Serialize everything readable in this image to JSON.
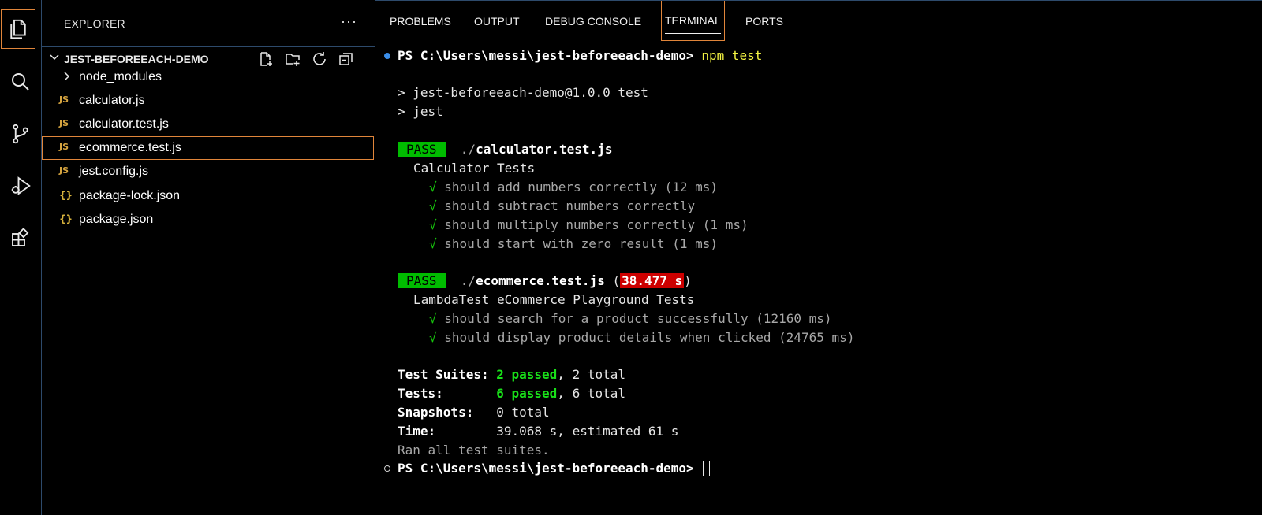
{
  "explorer": {
    "title": "EXPLORER",
    "more": "···",
    "folder_name": "JEST-BEFOREEACH-DEMO",
    "items": [
      {
        "label": "node_modules",
        "icon": "chevron-right-icon",
        "glyph": ">"
      },
      {
        "label": "calculator.js",
        "icon": "js-file-icon",
        "glyph": "JS"
      },
      {
        "label": "calculator.test.js",
        "icon": "js-file-icon",
        "glyph": "JS"
      },
      {
        "label": "ecommerce.test.js",
        "icon": "js-file-icon",
        "glyph": "JS",
        "selected": true
      },
      {
        "label": "jest.config.js",
        "icon": "js-file-icon",
        "glyph": "JS"
      },
      {
        "label": "package-lock.json",
        "icon": "json-file-icon",
        "glyph": "{}"
      },
      {
        "label": "package.json",
        "icon": "json-file-icon",
        "glyph": "{}"
      }
    ]
  },
  "panel": {
    "tabs": [
      "PROBLEMS",
      "OUTPUT",
      "DEBUG CONSOLE",
      "TERMINAL",
      "PORTS"
    ],
    "active_tab": "TERMINAL"
  },
  "terminal": {
    "prompt": "PS C:\\Users\\messi\\jest-beforeeach-demo> ",
    "command": "npm test",
    "script_line1": "> jest-beforeeach-demo@1.0.0 test",
    "script_line2": "> jest",
    "pass_label": "PASS",
    "suite1_prefix": "./",
    "suite1_file": "calculator.test.js",
    "suite1_name": "Calculator Tests",
    "suite1_tests": [
      "should add numbers correctly (12 ms)",
      "should subtract numbers correctly",
      "should multiply numbers correctly (1 ms)",
      "should start with zero result (1 ms)"
    ],
    "suite2_prefix": "./",
    "suite2_file": "ecommerce.test.js",
    "suite2_open": " (",
    "suite2_time": "38.477 s",
    "suite2_close": ")",
    "suite2_name": "LambdaTest eCommerce Playground Tests",
    "suite2_tests": [
      "should search for a product successfully (12160 ms)",
      "should display product details when clicked (24765 ms)"
    ],
    "check": "√",
    "summary": {
      "suites_label": "Test Suites: ",
      "suites_passed": "2 passed",
      "suites_rest": ", 2 total",
      "tests_label": "Tests:       ",
      "tests_passed": "6 passed",
      "tests_rest": ", 6 total",
      "snapshots_label": "Snapshots:   ",
      "snapshots_value": "0 total",
      "time_label": "Time:        ",
      "time_value": "39.068 s, estimated 61 s",
      "ran": "Ran all test suites."
    },
    "final_prompt": "PS C:\\Users\\messi\\jest-beforeeach-demo> "
  },
  "colors": {
    "accent_border": "#e0853a",
    "pass_bg": "#00bc00",
    "time_bg": "#cd0000",
    "command": "#f5f543"
  }
}
